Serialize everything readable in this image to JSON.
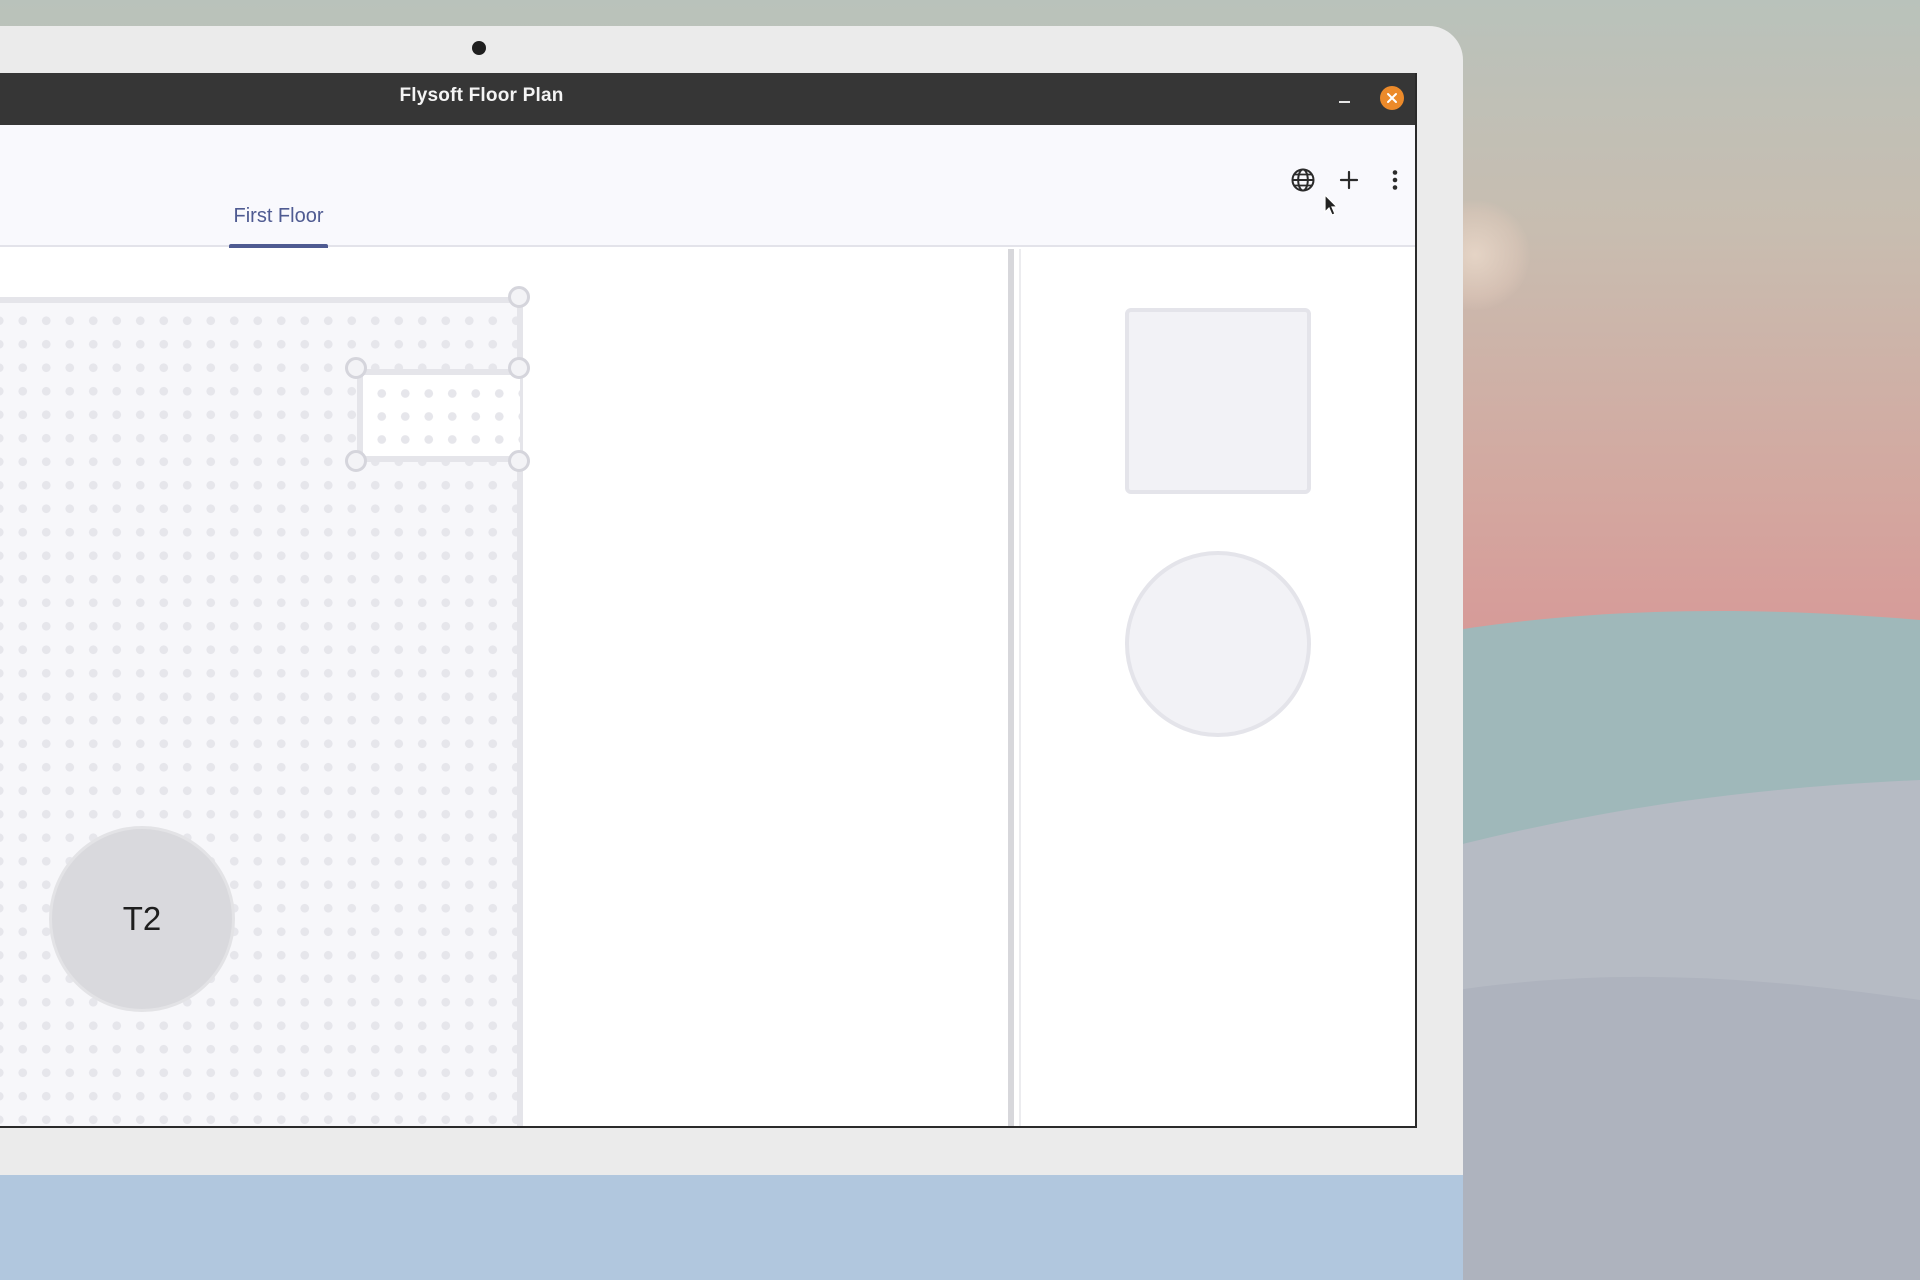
{
  "window": {
    "title": "Flysoft Floor Plan",
    "controls": {
      "minimize_icon": "minimize-icon",
      "close_icon": "close-icon",
      "close_color": "#ec8a2a"
    }
  },
  "toolbar": {
    "icons": [
      "globe-icon",
      "plus-icon",
      "more-vertical-icon"
    ]
  },
  "tabs": [
    {
      "label": "First Floor",
      "active": true
    }
  ],
  "canvas": {
    "tables": [
      {
        "label": "T2",
        "shape": "circle"
      }
    ]
  },
  "sidebar": {
    "shapes": [
      "square",
      "circle"
    ]
  },
  "colors": {
    "accent": "#4f5b92",
    "titlebar": "#363636",
    "close_button": "#ec8a2a"
  }
}
